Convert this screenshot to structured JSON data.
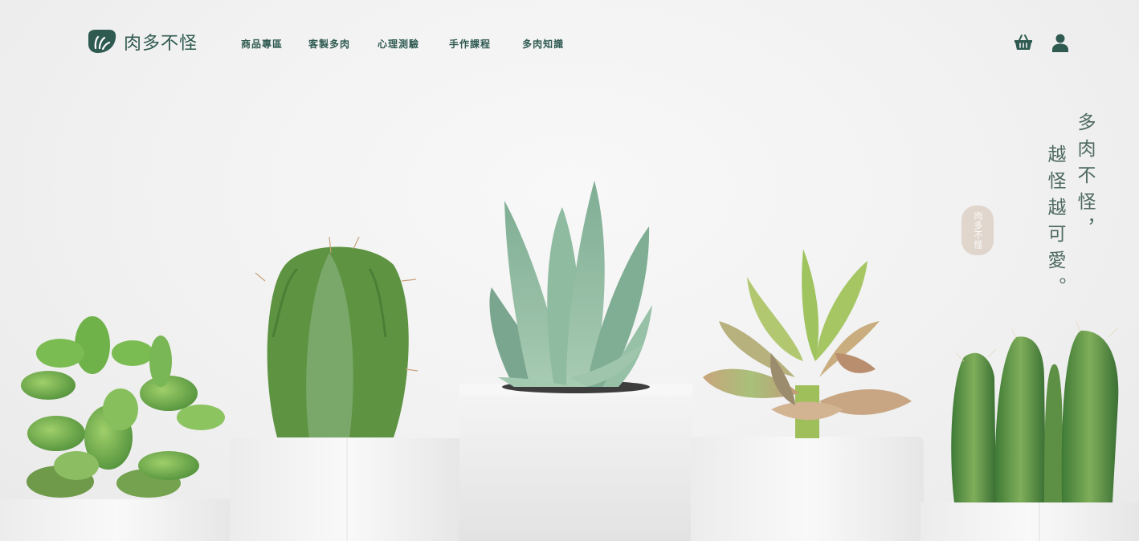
{
  "brand": {
    "logo_text": "肉多不怪",
    "colors": {
      "primary": "#2f5a50",
      "background": "#f1f1f1"
    }
  },
  "nav": {
    "items": [
      {
        "label": "商品專區"
      },
      {
        "label": "客製多肉"
      },
      {
        "label": "心理測驗"
      },
      {
        "label": "手作課程"
      },
      {
        "label": "多肉知識"
      }
    ]
  },
  "header_icons": {
    "cart": "basket-icon",
    "account": "user-icon"
  },
  "hero": {
    "slogan_line_1": "多肉不怪，",
    "slogan_line_2": "越怪越可愛。",
    "stamp_text": "肉多不怪",
    "image": "succulent-plants-on-pedestals"
  }
}
